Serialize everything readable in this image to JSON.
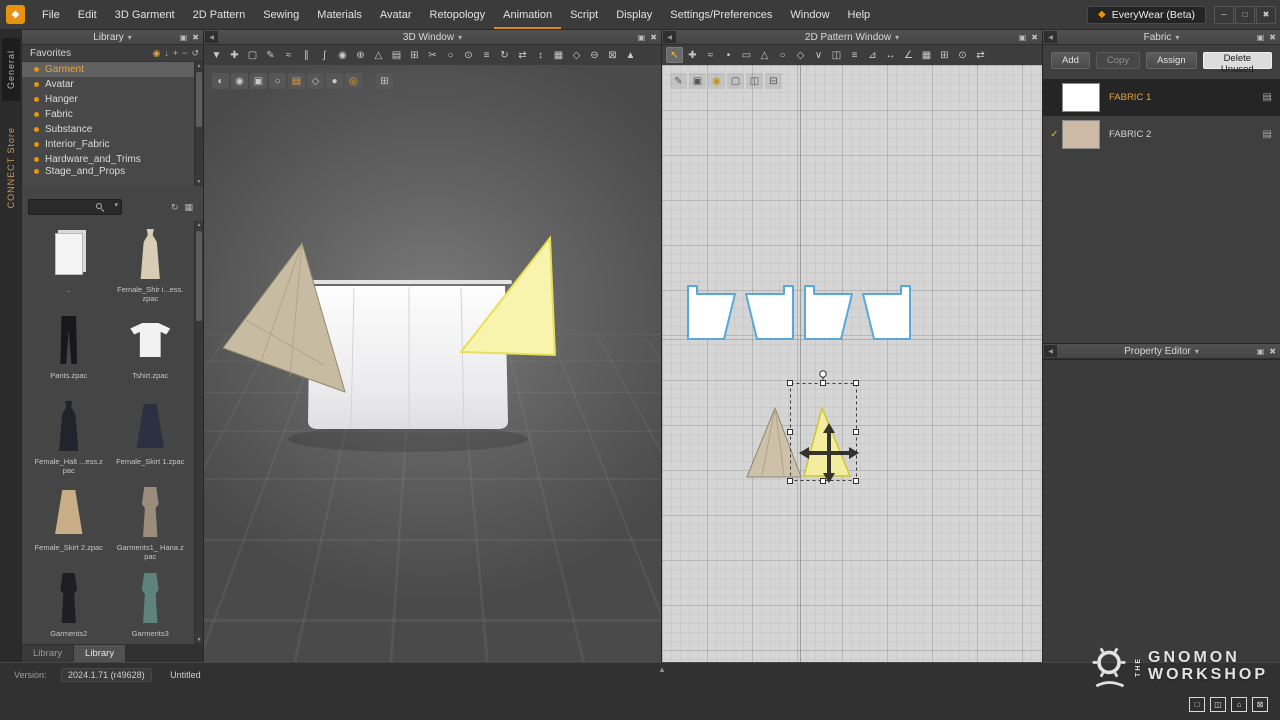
{
  "colors": {
    "accent_orange": "#e8930f",
    "highlight_text": "#e8a43e",
    "pattern_outline_blue": "#5aa7dd",
    "selected_pattern_yellow": "#f3eda0"
  },
  "app": {
    "logo_glyph": "◆",
    "title_button": "EveryWear (Beta)",
    "window_controls": [
      {
        "name": "minimize-icon",
        "glyph": "─"
      },
      {
        "name": "restore-icon",
        "glyph": "□"
      },
      {
        "name": "close-icon",
        "glyph": "✖"
      }
    ]
  },
  "menu": {
    "items": [
      {
        "label": "File"
      },
      {
        "label": "Edit"
      },
      {
        "label": "3D Garment"
      },
      {
        "label": "2D Pattern"
      },
      {
        "label": "Sewing"
      },
      {
        "label": "Materials"
      },
      {
        "label": "Avatar"
      },
      {
        "label": "Retopology"
      },
      {
        "label": "Animation",
        "cls": "accent"
      },
      {
        "label": "Script"
      },
      {
        "label": "Display"
      },
      {
        "label": "Settings/Preferences"
      },
      {
        "label": "Window"
      },
      {
        "label": "Help"
      }
    ]
  },
  "side_tabs": {
    "general": "General",
    "connect": "CONNECT Store"
  },
  "panels": {
    "library_title": "Library",
    "window3d_title": "3D Window",
    "window2d_title": "2D Pattern Window",
    "fabric_title": "Fabric",
    "property_title": "Property Editor",
    "caret": "▾",
    "undock_glyph": "▣",
    "close_glyph": "✖",
    "collapse_glyph": "◀"
  },
  "library": {
    "favorites_label": "Favorites",
    "favorites_icons": [
      {
        "name": "sync-status-icon",
        "glyph": "◉",
        "cls": "accent"
      },
      {
        "name": "download-icon",
        "glyph": "↓"
      },
      {
        "name": "add-favorite-icon",
        "glyph": "+"
      },
      {
        "name": "remove-favorite-icon",
        "glyph": "−"
      },
      {
        "name": "refresh-icon",
        "glyph": "↺"
      }
    ],
    "categories": [
      {
        "label": "Garment",
        "cls": "selected"
      },
      {
        "label": "Avatar"
      },
      {
        "label": "Hanger"
      },
      {
        "label": "Fabric"
      },
      {
        "label": "Substance"
      },
      {
        "label": "Interior_Fabric"
      },
      {
        "label": "Hardware_and_Trims"
      },
      {
        "label": "Stage_and_Props",
        "cls": "clipped"
      }
    ],
    "search_value": "",
    "search_caret": "▾",
    "search_side_icons": [
      {
        "name": "refresh-library-icon",
        "glyph": "↻"
      },
      {
        "name": "view-mode-icon",
        "glyph": "▦"
      }
    ],
    "items": [
      {
        "label": "..",
        "shape": "shape-folder",
        "color": "#f4f4f4"
      },
      {
        "label": "Female_Shir i...ess.zpac",
        "shape": "shape-dress",
        "color": "#d9ccb5"
      },
      {
        "label": "Pants.zpac",
        "shape": "shape-pants",
        "color": "#17171c"
      },
      {
        "label": "Tshirt.zpac",
        "shape": "shape-tshirt",
        "color": "#f2f2f2"
      },
      {
        "label": "Female_Halt ...ess.zpac",
        "shape": "shape-dress",
        "color": "#23232d"
      },
      {
        "label": "Female_Skirt 1.zpac",
        "shape": "shape-skirt",
        "color": "#2d3040"
      },
      {
        "label": "Female_Skirt 2.zpac",
        "shape": "shape-skirt",
        "color": "#c8ae86"
      },
      {
        "label": "Garments1_ Hana.zpac",
        "shape": "shape-outfit",
        "color": "#9a8d7b"
      },
      {
        "label": "Garments2",
        "shape": "shape-outfit",
        "color": "#1e1e24"
      },
      {
        "label": "Garments3",
        "shape": "shape-outfit",
        "color": "#5e827c"
      }
    ],
    "tabs": [
      {
        "label": "Library"
      },
      {
        "label": "Library",
        "cls": "active"
      }
    ]
  },
  "toolbar3d": {
    "icons": [
      {
        "name": "simulate-icon",
        "glyph": "▼"
      },
      {
        "name": "select-move-icon",
        "glyph": "✚"
      },
      {
        "name": "select-box-icon",
        "glyph": "▢"
      },
      {
        "name": "pen-3d-icon",
        "glyph": "✎"
      },
      {
        "name": "edit-sewing-icon",
        "glyph": "≈"
      },
      {
        "name": "segment-sewing-icon",
        "glyph": "∥"
      },
      {
        "name": "free-sewing-icon",
        "glyph": "∫"
      },
      {
        "name": "pin-icon",
        "glyph": "◉"
      },
      {
        "name": "tack-icon",
        "glyph": "⊕"
      },
      {
        "name": "fold-arrangement-icon",
        "glyph": "△"
      },
      {
        "name": "arrangement-point-icon",
        "glyph": "▤"
      },
      {
        "name": "grid-snap-icon",
        "glyph": "⊞"
      },
      {
        "name": "cut-sew-icon",
        "glyph": "✂"
      },
      {
        "name": "steam-icon",
        "glyph": "○"
      },
      {
        "name": "solidify-icon",
        "glyph": "⊙"
      },
      {
        "name": "layer-icon",
        "glyph": "≡"
      },
      {
        "name": "rotate-icon",
        "glyph": "↻"
      },
      {
        "name": "flip-icon",
        "glyph": "⇄"
      },
      {
        "name": "measure-icon",
        "glyph": "↕"
      },
      {
        "name": "texture-icon",
        "glyph": "▦"
      },
      {
        "name": "button-tool-icon",
        "glyph": "◇"
      },
      {
        "name": "zipper-icon",
        "glyph": "⊖"
      },
      {
        "name": "topstitch-icon",
        "glyph": "⊠"
      },
      {
        "name": "wind-icon",
        "glyph": "▲"
      }
    ]
  },
  "viewport3d": {
    "icons": [
      {
        "name": "render-style-icon",
        "glyph": "◐"
      },
      {
        "name": "show-avatar-icon",
        "glyph": "◉"
      },
      {
        "name": "show-arrangement-icon",
        "glyph": "▣"
      },
      {
        "name": "show-pins-icon",
        "glyph": "○"
      },
      {
        "name": "show-garment-icon",
        "glyph": "▤",
        "cls": "accent"
      },
      {
        "name": "show-seams-icon",
        "glyph": "◇"
      },
      {
        "name": "show-mannequin-icon",
        "glyph": "●"
      },
      {
        "name": "safety-frame-icon",
        "glyph": "◎",
        "cls": "accent"
      },
      {
        "name": "scene-options-icon",
        "glyph": "⊞",
        "cls": "detached"
      }
    ]
  },
  "toolbar2d": {
    "icons": [
      {
        "name": "transform-pattern-icon",
        "glyph": "↖",
        "cls": "active"
      },
      {
        "name": "edit-pattern-icon",
        "glyph": "✚"
      },
      {
        "name": "edit-curvature-icon",
        "glyph": "≈"
      },
      {
        "name": "add-point-icon",
        "glyph": "•"
      },
      {
        "name": "rectangle-tool-icon",
        "glyph": "▭"
      },
      {
        "name": "polygon-tool-icon",
        "glyph": "△"
      },
      {
        "name": "circle-tool-icon",
        "glyph": "○"
      },
      {
        "name": "dart-tool-icon",
        "glyph": "◇"
      },
      {
        "name": "notch-tool-icon",
        "glyph": "∨"
      },
      {
        "name": "trace-tool-icon",
        "glyph": "◫"
      },
      {
        "name": "seam-tape-icon",
        "glyph": "≡"
      },
      {
        "name": "grading-icon",
        "glyph": "⊿"
      },
      {
        "name": "measure-2d-icon",
        "glyph": "↔"
      },
      {
        "name": "angle-icon",
        "glyph": "∠"
      },
      {
        "name": "texture-editor-icon",
        "glyph": "▦"
      },
      {
        "name": "print-layout-icon",
        "glyph": "⊞"
      },
      {
        "name": "zoom-tool-icon",
        "glyph": "⊙"
      },
      {
        "name": "symmetry-icon",
        "glyph": "⇄"
      }
    ]
  },
  "viewport2d": {
    "icons": [
      {
        "name": "edit-texture-icon",
        "glyph": "✎"
      },
      {
        "name": "show-pattern-icon",
        "glyph": "▣"
      },
      {
        "name": "show-sewing-icon",
        "glyph": "◉",
        "cls": "accent"
      },
      {
        "name": "show-base-pattern-icon",
        "glyph": "▢"
      },
      {
        "name": "show-layers-icon",
        "glyph": "◫"
      },
      {
        "name": "print-preview-icon",
        "glyph": "⊟"
      }
    ]
  },
  "fabric": {
    "row_icon": "▤",
    "buttons": [
      {
        "label": "Add",
        "name": "add-fabric-button"
      },
      {
        "label": "Copy",
        "name": "copy-fabric-button",
        "cls": "disabled"
      },
      {
        "label": "Assign",
        "name": "assign-fabric-button"
      },
      {
        "label": "Delete Unused",
        "name": "delete-unused-button",
        "cls": "light"
      }
    ],
    "items": [
      {
        "name": "FABRIC 1",
        "swatch": "#ffffff",
        "cls": "selected",
        "check": ""
      },
      {
        "name": "FABRIC 2",
        "swatch": "#ccb9a6",
        "cls": "",
        "check": "✓"
      }
    ]
  },
  "statusbar": {
    "version_label": "Version:",
    "version_value": "2024.1.71 (r49628)",
    "file_name": "Untitled",
    "collapse_glyph": "▲"
  },
  "watermark": {
    "the": "THE",
    "line1": "GNOMON",
    "line2": "WORKSHOP",
    "controls": [
      {
        "name": "frames-icon",
        "glyph": "□"
      },
      {
        "name": "split-view-icon",
        "glyph": "◫"
      },
      {
        "name": "home-icon",
        "glyph": "⌂"
      },
      {
        "name": "grid-close-icon",
        "glyph": "⊠"
      }
    ]
  }
}
